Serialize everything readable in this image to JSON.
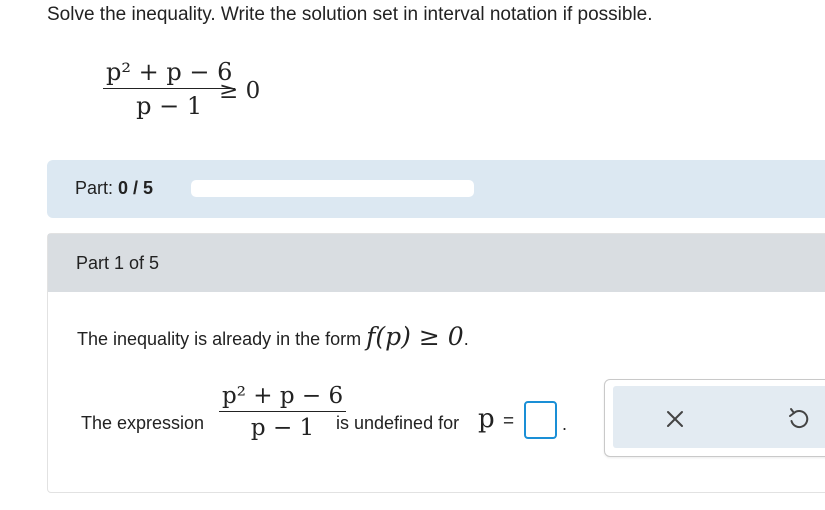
{
  "problem": {
    "prompt": "Solve the inequality. Write the solution set in interval notation if possible.",
    "numerator": "p² + p − 6",
    "denominator": "p − 1",
    "relation": "≥ 0"
  },
  "progress": {
    "label": "Part:",
    "value": "0 / 5",
    "completed": 0,
    "total": 5
  },
  "part": {
    "title": "Part 1 of 5",
    "statement_prefix": "The inequality is already in the form",
    "statement_math": "f(p) ≥ 0",
    "statement_suffix": ".",
    "expr_prefix": "The expression",
    "expr_numerator": "p² + p − 6",
    "expr_denominator": "p − 1",
    "expr_suffix": "is undefined for",
    "variable": "p",
    "equals": "=",
    "answer_value": "",
    "period": "."
  },
  "icons": {
    "clear": "close-x-icon",
    "undo": "undo-arrow-icon"
  },
  "colors": {
    "progress_bg": "#dce8f2",
    "header_bg": "#d9dde1",
    "input_border": "#1a8fd6",
    "tool_bg": "#e3ebf2"
  }
}
